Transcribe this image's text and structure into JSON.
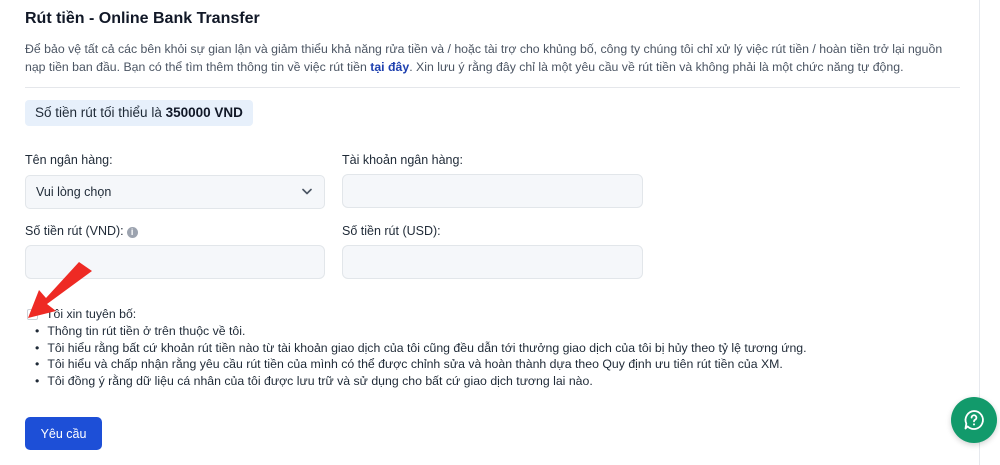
{
  "page": {
    "title": "Rút tiền - Online Bank Transfer",
    "description_before_link": "Để bảo vệ tất cả các bên khỏi sự gian lận và giảm thiểu khả năng rửa tiền và / hoặc tài trợ cho khủng bố, công ty chúng tôi chỉ xử lý việc rút tiền / hoàn tiền trở lại nguồn nạp tiền ban đầu. Bạn có thể tìm thêm thông tin về việc rút tiền ",
    "description_link": "tại đây",
    "description_after_link": ". Xin lưu ý rằng đây chỉ là một yêu cầu về rút tiền và không phải là một chức năng tự động."
  },
  "minimum": {
    "prefix": "Số tiền rút tối thiểu là ",
    "amount": "350000 VND"
  },
  "form": {
    "bank_name_label": "Tên ngân hàng:",
    "bank_select_value": "Vui lòng chọn",
    "bank_account_label": "Tài khoản ngân hàng:",
    "bank_account_value": "",
    "amount_vnd_label": "Số tiền rút (VND):",
    "amount_vnd_value": "",
    "amount_usd_label": "Số tiền rút (USD):",
    "amount_usd_value": ""
  },
  "declaration": {
    "title": "Tôi xin tuyên bố:",
    "items": [
      "Thông tin rút tiền ở trên thuộc về tôi.",
      "Tôi hiểu rằng bất cứ khoản rút tiền nào từ tài khoản giao dịch của tôi cũng đều dẫn tới thưởng giao dịch của tôi bị hủy theo tỷ lệ tương ứng.",
      "Tôi hiểu và chấp nhận rằng yêu cầu rút tiền của mình có thể được chỉnh sửa và hoàn thành dựa theo Quy định ưu tiên rút tiền của XM.",
      "Tôi đồng ý rằng dữ liệu cá nhân của tôi được lưu trữ và sử dụng cho bất cứ giao dịch tương lai nào."
    ]
  },
  "submit_label": "Yêu cầu",
  "icons": {
    "chevron": "chevron-down-icon",
    "info": "info-icon",
    "help": "help-icon",
    "arrow": "red-arrow-annotation"
  },
  "colors": {
    "primary": "#1d4fd7",
    "link": "#1e40af",
    "badge_bg": "#e7f0fb",
    "help_fab": "#129a6b",
    "annotation": "#ee2a24"
  }
}
